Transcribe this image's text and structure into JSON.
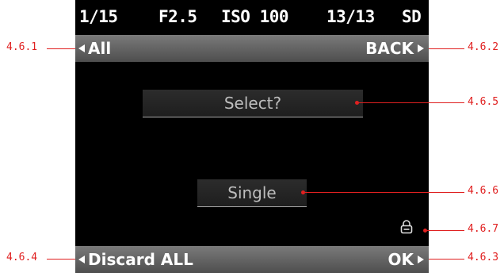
{
  "status": {
    "shutter": "1/15",
    "aperture": "F2.5",
    "iso": "ISO 100",
    "count": "13/13",
    "storage": "SD"
  },
  "top_bar": {
    "left_label": "All",
    "right_label": "BACK"
  },
  "dialog": {
    "title": "Select?",
    "option": "Single"
  },
  "bottom_bar": {
    "left_label": "Discard ALL",
    "right_label": "OK"
  },
  "callouts": {
    "c1": "4.6.1",
    "c2": "4.6.2",
    "c3": "4.6.3",
    "c4": "4.6.4",
    "c5": "4.6.5",
    "c6": "4.6.6",
    "c7": "4.6.7"
  },
  "colors": {
    "callout": "#e02020",
    "bar": "#5a5a5a"
  },
  "icons": {
    "lock": "lock-icon"
  }
}
